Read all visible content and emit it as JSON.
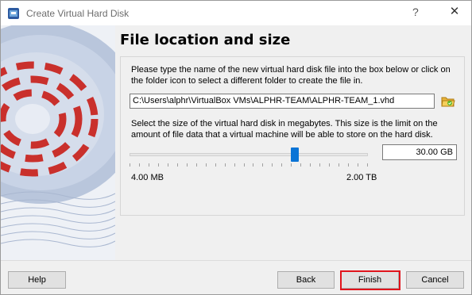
{
  "window": {
    "title": "Create Virtual Hard Disk",
    "help_glyph": "?",
    "close_glyph": "✕"
  },
  "page": {
    "heading": "File location and size",
    "location_description": "Please type the name of the new virtual hard disk file into the box below or click on the folder icon to select a different folder to create the file in.",
    "file_path": "C:\\Users\\alphr\\VirtualBox VMs\\ALPHR-TEAM\\ALPHR-TEAM_1.vhd",
    "size_description": "Select the size of the virtual hard disk in megabytes. This size is the limit on the amount of file data that a virtual machine will be able to store on the hard disk.",
    "size_value": "30.00 GB",
    "slider_min_label": "4.00 MB",
    "slider_max_label": "2.00 TB",
    "slider_fraction": 0.69
  },
  "buttons": {
    "help": "Help",
    "back": "Back",
    "finish": "Finish",
    "cancel": "Cancel"
  },
  "colors": {
    "highlight": "#e1141c",
    "slider_thumb": "#0a74d6"
  }
}
